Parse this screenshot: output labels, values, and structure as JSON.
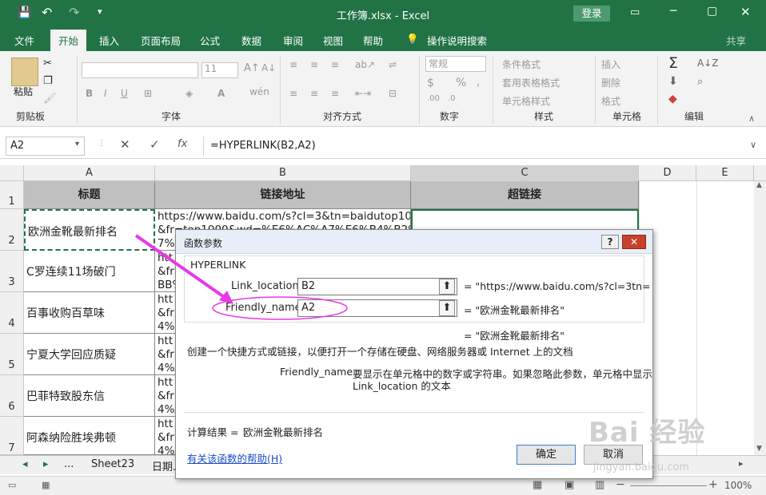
{
  "titlebar": {
    "title": "工作簿.xlsx  -  Excel",
    "login": "登录"
  },
  "tabs": {
    "file": "文件",
    "home": "开始",
    "insert": "插入",
    "layout": "页面布局",
    "formulas": "公式",
    "data": "数据",
    "review": "审阅",
    "view": "视图",
    "help": "帮助",
    "tell": "操作说明搜索",
    "share": "共享"
  },
  "ribbon": {
    "paste": "粘贴",
    "clipboard": "剪贴板",
    "font": "字体",
    "font_size": "11",
    "align": "对齐方式",
    "number_format": "常规",
    "number": "数字",
    "cond_format": "条件格式",
    "table_format": "套用表格格式",
    "cell_style": "单元格样式",
    "styles": "样式",
    "insert": "插入",
    "delete": "删除",
    "format": "格式",
    "cells": "单元格",
    "editing": "编辑",
    "bold": "B",
    "italic": "I",
    "underline": "U"
  },
  "formula_bar": {
    "namebox": "A2",
    "fx": "fx",
    "formula": "=HYPERLINK(B2,A2)"
  },
  "columns": [
    "A",
    "B",
    "C",
    "D",
    "E"
  ],
  "rows": [
    "1",
    "2",
    "3",
    "4",
    "5",
    "6",
    "7"
  ],
  "table": {
    "headers": [
      "标题",
      "链接地址",
      "超链接"
    ],
    "titles": [
      "欧洲金靴最新排名",
      "C罗连续11场破门",
      "百事收购百草味",
      "宁夏大学回应质疑",
      "巴菲特致股东信",
      "阿森纳险胜埃弗顿"
    ],
    "url_row1": "https://www.baidu.com/s?cl=3&tn=baidutop10\n&fr=top1000&wd=%E6%AC%A7%E6%B4%B2%E9%87\n7%9",
    "url_rows": [
      "htt\n&fr\nBB%",
      "htt\n&fr\n4%B",
      "htt\n&fr\n4%A",
      "htt\n&fr\n4%A",
      "htt\n&fr\n4%A"
    ]
  },
  "sheet_tabs": {
    "nav_prev": "◂",
    "nav_next": "▸",
    "more": "...",
    "sheet": "Sheet23",
    "sheet2": "日期..."
  },
  "status": {
    "zoom": "100%"
  },
  "dialog": {
    "title": "函数参数",
    "help_btn": "?",
    "close_btn": "✕",
    "func": "HYPERLINK",
    "arg1_label": "Link_location",
    "arg1_value": "B2",
    "arg1_result": "=  \"https://www.baidu.com/s?cl=3tn=",
    "arg2_label": "Friendly_name",
    "arg2_value": "A2",
    "arg2_result": "=  \"欧洲金靴最新排名\"",
    "result_line": "=  \"欧洲金靴最新排名\"",
    "description": "创建一个快捷方式或链接，以便打开一个存储在硬盘、网络服务器或  Internet 上的文档",
    "param_name": "Friendly_name",
    "param_desc1": "要显示在单元格中的数字或字符串。如果忽略此参数，单元格中显示",
    "param_desc2": "Link_location 的文本",
    "calc_label": "计算结果 =",
    "calc_value": "欧洲金靴最新排名",
    "help_link": "有关该函数的帮助(H)",
    "ok": "确定",
    "cancel": "取消"
  },
  "watermark": {
    "brand": "Bai 经验",
    "url": "jingyan.baidu.com"
  },
  "colors": {
    "excel_green": "#217346",
    "annotation": "#e838e8"
  }
}
